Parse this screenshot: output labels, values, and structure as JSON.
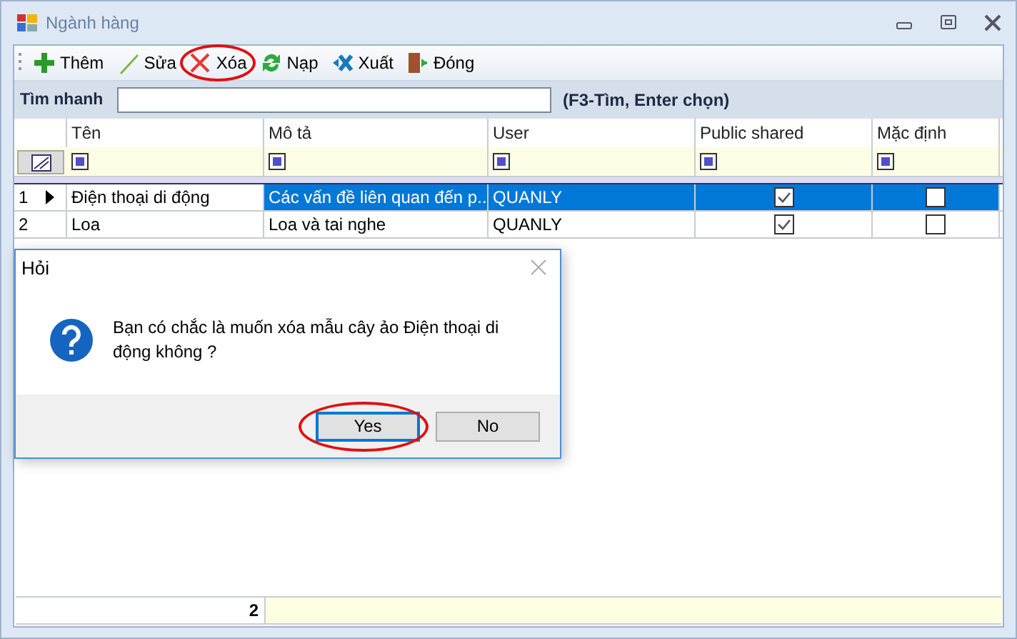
{
  "window": {
    "title": "Ngành hàng"
  },
  "toolbar": [
    {
      "kind": "add",
      "label": "Thêm",
      "highlighted": false
    },
    {
      "kind": "edit",
      "label": "Sửa",
      "highlighted": false
    },
    {
      "kind": "delete",
      "label": "Xóa",
      "highlighted": true
    },
    {
      "kind": "reload",
      "label": "Nạp",
      "highlighted": false
    },
    {
      "kind": "export",
      "label": "Xuất",
      "highlighted": false
    },
    {
      "kind": "close",
      "label": "Đóng",
      "highlighted": false
    }
  ],
  "quick_search": {
    "label": "Tìm nhanh",
    "hint": "(F3-Tìm, Enter chọn)"
  },
  "table": {
    "columns": [
      "Tên",
      "Mô tả",
      "User",
      "Public shared",
      "Mặc định"
    ],
    "rows": [
      {
        "number": "1",
        "current": true,
        "selected": true,
        "name": "Điện thoại di động",
        "description": "Các vấn đề liên quan đến p...",
        "user": "QUANLY",
        "public_shared": true,
        "default": false
      },
      {
        "number": "2",
        "current": false,
        "selected": false,
        "name": "Loa",
        "description": "Loa và tai nghe",
        "user": "QUANLY",
        "public_shared": true,
        "default": false
      }
    ],
    "footer_count": "2"
  },
  "dialog": {
    "title": "Hỏi",
    "message": "Bạn có chắc là muốn xóa mẫu cây ảo Điện thoại di động không ?",
    "buttons": [
      {
        "label": "Yes",
        "selected": true,
        "highlighted": true
      },
      {
        "label": "No",
        "selected": false,
        "highlighted": false
      }
    ]
  }
}
